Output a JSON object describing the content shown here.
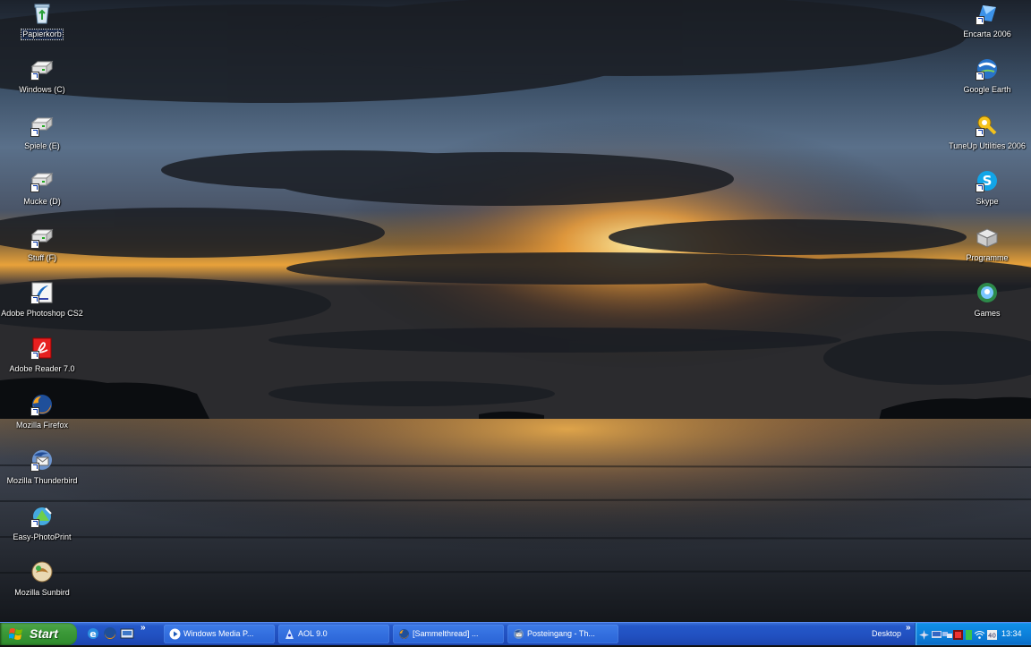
{
  "desktop": {
    "left_icons": [
      {
        "label": "Papierkorb",
        "icon": "recycle-bin-icon"
      },
      {
        "label": "Windows (C)",
        "icon": "drive-icon"
      },
      {
        "label": "Spiele (E)",
        "icon": "drive-icon"
      },
      {
        "label": "Mucke (D)",
        "icon": "drive-icon"
      },
      {
        "label": "Stuff (F)",
        "icon": "drive-icon"
      },
      {
        "label": "Adobe Photoshop CS2",
        "icon": "photoshop-icon"
      },
      {
        "label": "Adobe Reader 7.0",
        "icon": "adobe-reader-icon"
      },
      {
        "label": "Mozilla Firefox",
        "icon": "firefox-icon"
      },
      {
        "label": "Mozilla Thunderbird",
        "icon": "thunderbird-icon"
      },
      {
        "label": "Easy-PhotoPrint",
        "icon": "photoprint-icon"
      },
      {
        "label": "Mozilla Sunbird",
        "icon": "sunbird-icon"
      }
    ],
    "right_icons": [
      {
        "label": "Encarta 2006",
        "icon": "encarta-icon"
      },
      {
        "label": "Google Earth",
        "icon": "google-earth-icon"
      },
      {
        "label": "TuneUp Utilities 2006",
        "icon": "tuneup-icon"
      },
      {
        "label": "Skype",
        "icon": "skype-icon"
      },
      {
        "label": "Programme",
        "icon": "programs-box-icon"
      },
      {
        "label": "Games",
        "icon": "games-icon"
      }
    ]
  },
  "taskbar": {
    "start_label": "Start",
    "quick_launch": [
      "ie-icon",
      "firefox-icon",
      "show-desktop-icon"
    ],
    "quick_launch_more": "»",
    "tasks": [
      {
        "label": "Windows Media P...",
        "icon": "media-player-icon"
      },
      {
        "label": "AOL 9.0",
        "icon": "aol-icon"
      },
      {
        "label": "[Sammelthread] ...",
        "icon": "firefox-icon"
      },
      {
        "label": "Posteingang - Th...",
        "icon": "thunderbird-icon"
      }
    ],
    "desktop_toolbar_label": "Desktop",
    "desktop_toolbar_more": "»",
    "clock": "13:34"
  },
  "colors": {
    "taskbar_blue": "#2458c9",
    "start_green": "#3c9a39",
    "tray_blue": "#0c7ed8"
  }
}
